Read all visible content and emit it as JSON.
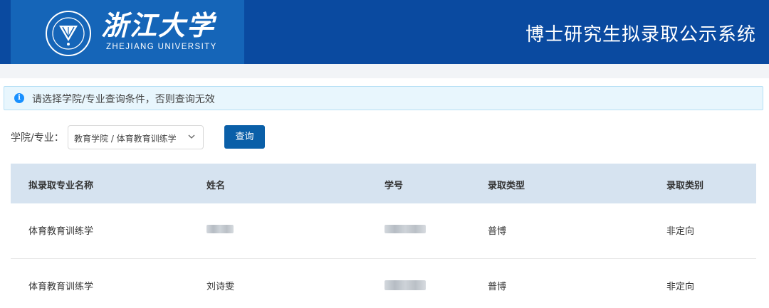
{
  "header": {
    "logo_cn": "浙江大学",
    "logo_en": "ZHEJIANG UNIVERSITY",
    "system_title": "博士研究生拟录取公示系统",
    "colors": {
      "bar": "#0a4aa0",
      "logo_box": "#1565b8"
    }
  },
  "notice": {
    "icon": "info-icon",
    "text": "请选择学院/专业查询条件，否则查询无效"
  },
  "filter": {
    "label": "学院/专业：",
    "selected": "教育学院 / 体育教育训练学",
    "query_button": "查询"
  },
  "table": {
    "columns": [
      "拟录取专业名称",
      "姓名",
      "学号",
      "录取类型",
      "录取类别"
    ],
    "rows": [
      {
        "major": "体育教育训练学",
        "name": "",
        "id": "",
        "type": "普博",
        "category": "非定向"
      },
      {
        "major": "体育教育训练学",
        "name": "刘诗雯",
        "id": "",
        "type": "普博",
        "category": "非定向"
      }
    ]
  }
}
